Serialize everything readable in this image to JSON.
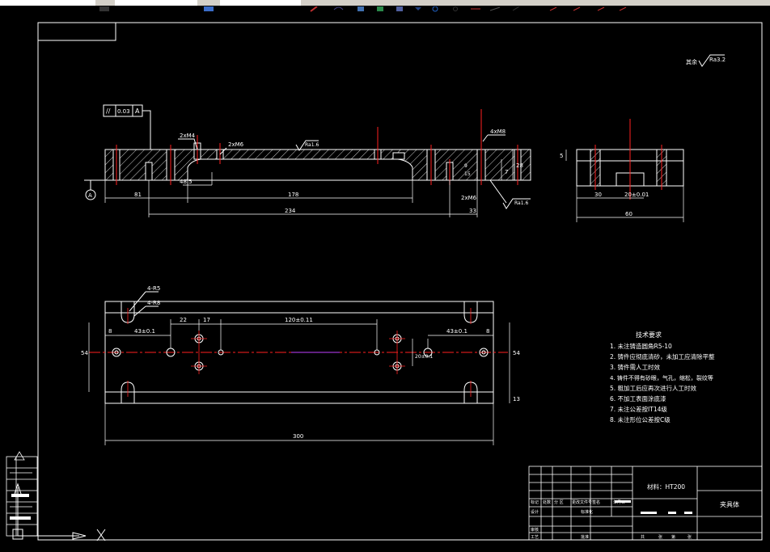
{
  "toolbar": {
    "color_field": "",
    "layer_field": ""
  },
  "drawing": {
    "surface_finish": {
      "label": "其余",
      "value": "Ra3.2"
    },
    "parallelism": {
      "symbol": "//",
      "tolerance": "0.03",
      "datum": "A"
    },
    "datum_label": "A",
    "top_view": {
      "callouts": {
        "c1": "2xM4",
        "c2": "2xM6",
        "c3": "4xM8",
        "c4": "2xM6"
      },
      "roughness": {
        "r1": "Ra1.6",
        "r2": "Ra1.6"
      },
      "dims": {
        "d81": "81",
        "d178": "178",
        "d234": "234",
        "d33": "33",
        "d485": "48.5",
        "d7": "7",
        "d28": "28",
        "d9": "9",
        "d15": "15"
      }
    },
    "side_view": {
      "dims": {
        "d30": "30",
        "d20": "20±0.01",
        "d60": "60",
        "d5": "5"
      }
    },
    "plan_view": {
      "callouts": {
        "h1": "4-R5",
        "h2": "4-R8"
      },
      "dims": {
        "d22": "22",
        "d17": "17",
        "d120": "120±0.11",
        "d8a": "8",
        "d43a": "43±0.1",
        "d43b": "43±0.1",
        "d8b": "8",
        "d54a": "54",
        "d54b": "54",
        "d13": "13",
        "d300": "300",
        "d20v": "20±0.1"
      }
    },
    "tech_req": {
      "title": "技术要求",
      "items": [
        "1. 未注铸造圆角R5-10",
        "2. 铸件应彻底清砂，未加工应清除平整",
        "3. 铸件需人工时效",
        "4. 铸件不得有砂眼，气孔，缩松，裂纹等",
        "5. 粗加工后应再次进行人工时效",
        "6. 不加工表面涂底漆",
        "7. 未注公差按IT14级",
        "8. 未注形位公差按C级"
      ]
    },
    "title_block": {
      "material": "材料：HT200",
      "name": "夹具体",
      "col_labels": {
        "a": "标记",
        "b": "处数",
        "c": "分 区",
        "d": "更改文件号",
        "e": "签名",
        "f": "年月日"
      },
      "sign": "标准化",
      "design": "设计",
      "review": "审核",
      "process": "工艺",
      "approve": "批准",
      "footer": {
        "a": "共",
        "b": "张",
        "c": "第",
        "d": "张"
      }
    }
  },
  "colors": {
    "background": "#000000",
    "lines": "#ffffff",
    "centerline": "#ff2020",
    "toolbar": "#d4d0c8"
  }
}
